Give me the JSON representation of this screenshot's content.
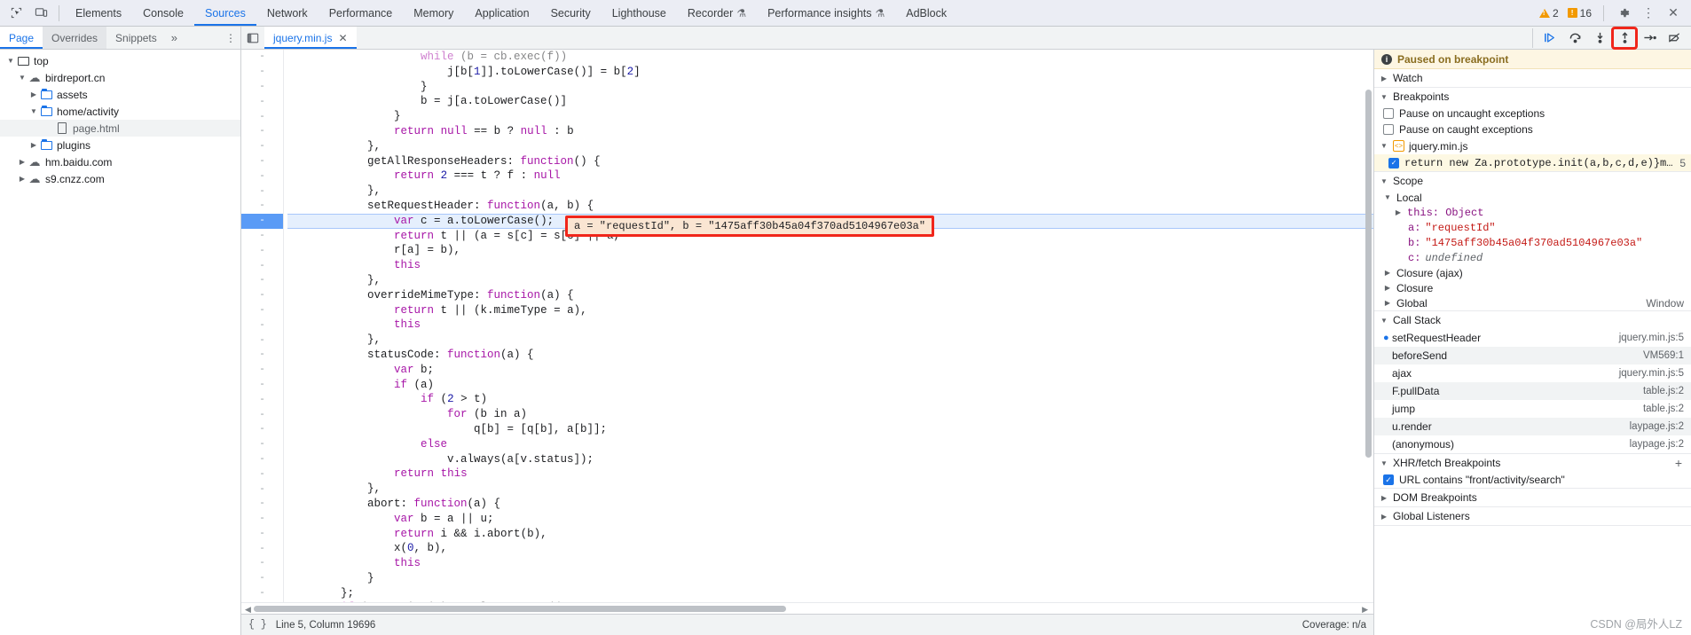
{
  "topbar": {
    "inspect_icon": "inspect-element-icon",
    "device_icon": "device-toolbar-icon",
    "tabs": [
      {
        "label": "Elements",
        "active": false,
        "flask": false
      },
      {
        "label": "Console",
        "active": false,
        "flask": false
      },
      {
        "label": "Sources",
        "active": true,
        "flask": false
      },
      {
        "label": "Network",
        "active": false,
        "flask": false
      },
      {
        "label": "Performance",
        "active": false,
        "flask": false
      },
      {
        "label": "Memory",
        "active": false,
        "flask": false
      },
      {
        "label": "Application",
        "active": false,
        "flask": false
      },
      {
        "label": "Security",
        "active": false,
        "flask": false
      },
      {
        "label": "Lighthouse",
        "active": false,
        "flask": false
      },
      {
        "label": "Recorder",
        "active": false,
        "flask": true
      },
      {
        "label": "Performance insights",
        "active": false,
        "flask": true
      },
      {
        "label": "AdBlock",
        "active": false,
        "flask": false
      }
    ],
    "warning_count": "2",
    "issue_count": "16",
    "settings_label": "⚙",
    "more_label": "⋮",
    "close_label": "✕"
  },
  "toolbar2": {
    "subtabs": [
      {
        "label": "Page",
        "active": true
      },
      {
        "label": "Overrides",
        "active": false
      },
      {
        "label": "Snippets",
        "active": false
      }
    ],
    "more_label": "»",
    "kebab_label": "⋮",
    "panel_toggle_label": "◧",
    "file_tab": {
      "label": "jquery.min.js",
      "close": "✕"
    },
    "debug_buttons": [
      {
        "name": "resume-script-execution-button",
        "glyph": "▶|",
        "highlighted": false
      },
      {
        "name": "step-over-next-function-call-button",
        "glyph": "↷",
        "highlighted": false
      },
      {
        "name": "step-into-next-function-call-button",
        "glyph": "↓",
        "highlighted": false
      },
      {
        "name": "step-out-of-current-function-button",
        "glyph": "↑",
        "highlighted": true
      },
      {
        "name": "step-button",
        "glyph": "→",
        "highlighted": false
      },
      {
        "name": "deactivate-breakpoints-button",
        "glyph": "⦸",
        "highlighted": false
      }
    ]
  },
  "navigator": {
    "tree": [
      {
        "label": "top",
        "depth": 0,
        "icon": "frame-icon",
        "twisty": "▼",
        "selected": false
      },
      {
        "label": "birdreport.cn",
        "depth": 1,
        "icon": "cloud-icon",
        "twisty": "▼",
        "selected": false
      },
      {
        "label": "assets",
        "depth": 2,
        "icon": "folder-icon",
        "twisty": "▶",
        "selected": false
      },
      {
        "label": "home/activity",
        "depth": 2,
        "icon": "folder-icon",
        "twisty": "▼",
        "selected": false
      },
      {
        "label": "page.html",
        "depth": 3,
        "icon": "document-icon",
        "twisty": "",
        "selected": true
      },
      {
        "label": "plugins",
        "depth": 2,
        "icon": "folder-icon",
        "twisty": "▶",
        "selected": false
      },
      {
        "label": "hm.baidu.com",
        "depth": 1,
        "icon": "cloud-icon",
        "twisty": "▶",
        "selected": false
      },
      {
        "label": "s9.cnzz.com",
        "depth": 1,
        "icon": "cloud-icon",
        "twisty": "▶",
        "selected": false
      }
    ]
  },
  "editor": {
    "lines": [
      {
        "text": "                    while (b = cb.exec(f))",
        "active": false,
        "clipped": true
      },
      {
        "text": "                        j[b[1]].toLowerCase()] = b[2]",
        "active": false
      },
      {
        "text": "                    }",
        "active": false
      },
      {
        "text": "                    b = j[a.toLowerCase()]",
        "active": false
      },
      {
        "text": "                }",
        "active": false
      },
      {
        "text": "                return null == b ? null : b",
        "active": false
      },
      {
        "text": "            },",
        "active": false
      },
      {
        "text": "            getAllResponseHeaders: function() {",
        "active": false
      },
      {
        "text": "                return 2 === t ? f : null",
        "active": false
      },
      {
        "text": "            },",
        "active": false
      },
      {
        "text": "            setRequestHeader: function(a, b) {",
        "active": false
      },
      {
        "text": "                var c = a.toLowerCase();",
        "active": true
      },
      {
        "text": "                return t || (a = s[c] = s[c] || a,",
        "active": false
      },
      {
        "text": "                r[a] = b),",
        "active": false
      },
      {
        "text": "                this",
        "active": false
      },
      {
        "text": "            },",
        "active": false
      },
      {
        "text": "            overrideMimeType: function(a) {",
        "active": false
      },
      {
        "text": "                return t || (k.mimeType = a),",
        "active": false
      },
      {
        "text": "                this",
        "active": false
      },
      {
        "text": "            },",
        "active": false
      },
      {
        "text": "            statusCode: function(a) {",
        "active": false
      },
      {
        "text": "                var b;",
        "active": false
      },
      {
        "text": "                if (a)",
        "active": false
      },
      {
        "text": "                    if (2 > t)",
        "active": false
      },
      {
        "text": "                        for (b in a)",
        "active": false
      },
      {
        "text": "                            q[b] = [q[b], a[b]];",
        "active": false
      },
      {
        "text": "                    else",
        "active": false
      },
      {
        "text": "                        v.always(a[v.status]);",
        "active": false
      },
      {
        "text": "                return this",
        "active": false
      },
      {
        "text": "            },",
        "active": false
      },
      {
        "text": "            abort: function(a) {",
        "active": false
      },
      {
        "text": "                var b = a || u;",
        "active": false
      },
      {
        "text": "                return i && i.abort(b),",
        "active": false
      },
      {
        "text": "                x(0, b),",
        "active": false
      },
      {
        "text": "                this",
        "active": false
      },
      {
        "text": "            }",
        "active": false
      },
      {
        "text": "        };",
        "active": false
      },
      {
        "text": "        if (o.promise(v).complete = p.add,",
        "active": false,
        "clipped": true
      }
    ],
    "gutter_mark": "-",
    "popup_text": "a = \"requestId\", b = \"1475aff30b45a04f370ad5104967e03a\""
  },
  "statusbar": {
    "braces_label": "{ }",
    "position": "Line 5, Column 19696",
    "coverage": "Coverage: n/a"
  },
  "debugger": {
    "paused_text": "Paused on breakpoint",
    "watch": {
      "label": "Watch",
      "twisty": "▶"
    },
    "breakpoints": {
      "label": "Breakpoints",
      "twisty": "▼",
      "options": [
        {
          "label": "Pause on uncaught exceptions",
          "checked": false
        },
        {
          "label": "Pause on caught exceptions",
          "checked": false
        }
      ],
      "source": {
        "file": "jquery.min.js",
        "twisty": "▼"
      },
      "entries": [
        {
          "code": "return new Za.prototype.init(a,b,c,d,e)}m.Tween…",
          "line": "5",
          "checked": true
        }
      ]
    },
    "scope": {
      "label": "Scope",
      "twisty": "▼",
      "local_label": "Local",
      "local_twisty": "▼",
      "this_label": "this: Object",
      "this_twisty": "▶",
      "vars": [
        {
          "name": "a:",
          "value": "\"requestId\"",
          "type": "string"
        },
        {
          "name": "b:",
          "value": "\"1475aff30b45a04f370ad5104967e03a\"",
          "type": "string"
        },
        {
          "name": "c:",
          "value": "undefined",
          "type": "undefined"
        }
      ],
      "closures": [
        {
          "label": "Closure (ajax)",
          "twisty": "▶",
          "right": ""
        },
        {
          "label": "Closure",
          "twisty": "▶",
          "right": ""
        },
        {
          "label": "Global",
          "twisty": "▶",
          "right": "Window"
        }
      ]
    },
    "callstack": {
      "label": "Call Stack",
      "twisty": "▼",
      "frames": [
        {
          "name": "setRequestHeader",
          "location": "jquery.min.js:5",
          "selected": true
        },
        {
          "name": "beforeSend",
          "location": "VM569:1",
          "selected": false
        },
        {
          "name": "ajax",
          "location": "jquery.min.js:5",
          "selected": false
        },
        {
          "name": "F.pullData",
          "location": "table.js:2",
          "selected": false
        },
        {
          "name": "jump",
          "location": "table.js:2",
          "selected": false
        },
        {
          "name": "u.render",
          "location": "laypage.js:2",
          "selected": false
        },
        {
          "name": "(anonymous)",
          "location": "laypage.js:2",
          "selected": false
        }
      ]
    },
    "xhr_breakpoints": {
      "label": "XHR/fetch Breakpoints",
      "twisty": "▼",
      "add_label": "+",
      "entries": [
        {
          "label": "URL contains \"front/activity/search\"",
          "checked": true
        }
      ]
    },
    "dom_breakpoints": {
      "label": "DOM Breakpoints",
      "twisty": "▶"
    },
    "global_listeners": {
      "label": "Global Listeners",
      "twisty": "▶"
    }
  },
  "watermark": "CSDN @局外人LZ",
  "colors": {
    "accent": "#1a73e8",
    "highlight_red": "#f0261b",
    "paused_bg": "#fdf6e3",
    "warn": "#f29900"
  }
}
